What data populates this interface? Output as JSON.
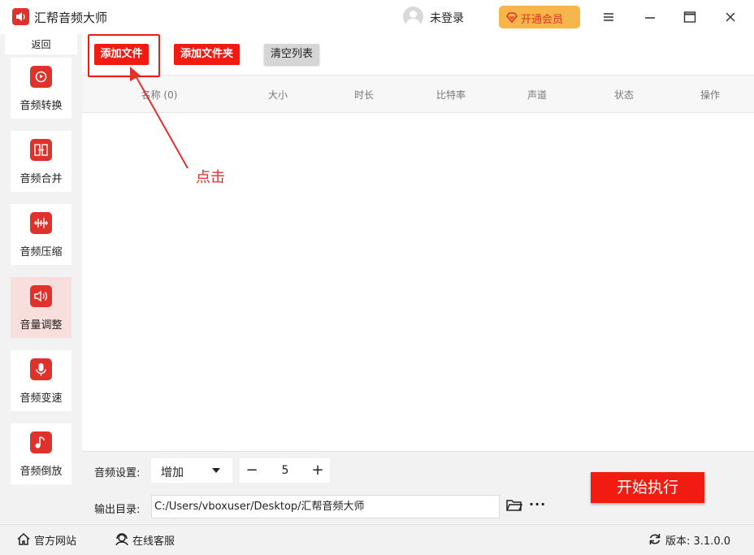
{
  "app": {
    "title": "汇帮音频大师"
  },
  "header": {
    "login_text": "未登录",
    "vip_label": "开通会员"
  },
  "sidebar": {
    "back_label": "返回",
    "items": [
      {
        "label": "音频转换",
        "icon": "audio-convert-icon",
        "active": false
      },
      {
        "label": "音频合并",
        "icon": "audio-merge-icon",
        "active": false
      },
      {
        "label": "音频压缩",
        "icon": "audio-compress-icon",
        "active": false
      },
      {
        "label": "音量调整",
        "icon": "volume-icon",
        "active": true
      },
      {
        "label": "音频变速",
        "icon": "microphone-icon",
        "active": false
      },
      {
        "label": "音频倒放",
        "icon": "music-note-icon",
        "active": false
      }
    ]
  },
  "toolbar": {
    "add_file": "添加文件",
    "add_folder": "添加文件夹",
    "clear_list": "清空列表"
  },
  "table": {
    "columns": [
      "名称 (0)",
      "大小",
      "时长",
      "比特率",
      "声道",
      "状态",
      "操作"
    ]
  },
  "annotation": {
    "text": "点击"
  },
  "settings": {
    "audio_label": "音频设置:",
    "mode_value": "增加",
    "step_value": "5",
    "output_label": "输出目录:",
    "output_path": "C:/Users/vboxuser/Desktop/汇帮音频大师",
    "start_button": "开始执行"
  },
  "statusbar": {
    "website": "官方网站",
    "support": "在线客服",
    "version": "版本:  3.1.0.0"
  },
  "colors": {
    "accent": "#f21b12",
    "vip": "#f7b64a",
    "sidebar_active": "#f9dede"
  }
}
